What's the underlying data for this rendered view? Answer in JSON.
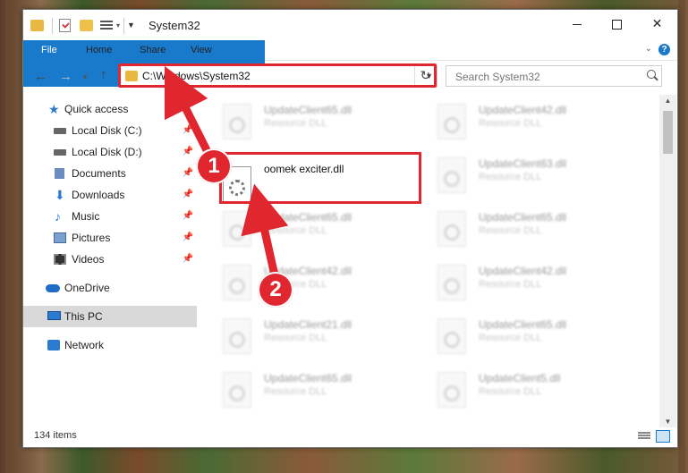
{
  "window": {
    "title": "System32",
    "minimize": "",
    "maximize": "",
    "close": "✕"
  },
  "ribbon": {
    "tabs": [
      "File",
      "Home",
      "Share",
      "View"
    ],
    "help": "?"
  },
  "address": {
    "path": "C:\\Windows\\System32",
    "search_placeholder": "Search System32"
  },
  "nav": {
    "items": [
      {
        "label": "Quick access"
      },
      {
        "label": "Local Disk (C:)"
      },
      {
        "label": "Local Disk (D:)"
      },
      {
        "label": "Documents"
      },
      {
        "label": "Downloads"
      },
      {
        "label": "Music"
      },
      {
        "label": "Pictures"
      },
      {
        "label": "Videos"
      },
      {
        "label": "OneDrive"
      },
      {
        "label": "This PC"
      },
      {
        "label": "Network"
      }
    ]
  },
  "files": [
    {
      "name": "UpdateClient65.dll",
      "type": "Resource DLL"
    },
    {
      "name": "UpdateClient42.dll",
      "type": "Resource DLL"
    },
    {
      "name": "oomek exciter.dll",
      "type": ""
    },
    {
      "name": "UpdateClient63.dll",
      "type": "Resource DLL"
    },
    {
      "name": "UpdateClient65.dll",
      "type": "Resource DLL"
    },
    {
      "name": "UpdateClient65.dll",
      "type": "Resource DLL"
    },
    {
      "name": "UpdateClient42.dll",
      "type": "Resource DLL"
    },
    {
      "name": "UpdateClient42.dll",
      "type": "Resource DLL"
    },
    {
      "name": "UpdateClient21.dll",
      "type": "Resource DLL"
    },
    {
      "name": "UpdateClient65.dll",
      "type": "Resource DLL"
    },
    {
      "name": "UpdateClient65.dll",
      "type": "Resource DLL"
    },
    {
      "name": "UpdateClient5.dll",
      "type": "Resource DLL"
    }
  ],
  "status": {
    "item_count": "134 items"
  },
  "annotations": {
    "step1": "1",
    "step2": "2",
    "highlight_color": "#e0262f"
  }
}
